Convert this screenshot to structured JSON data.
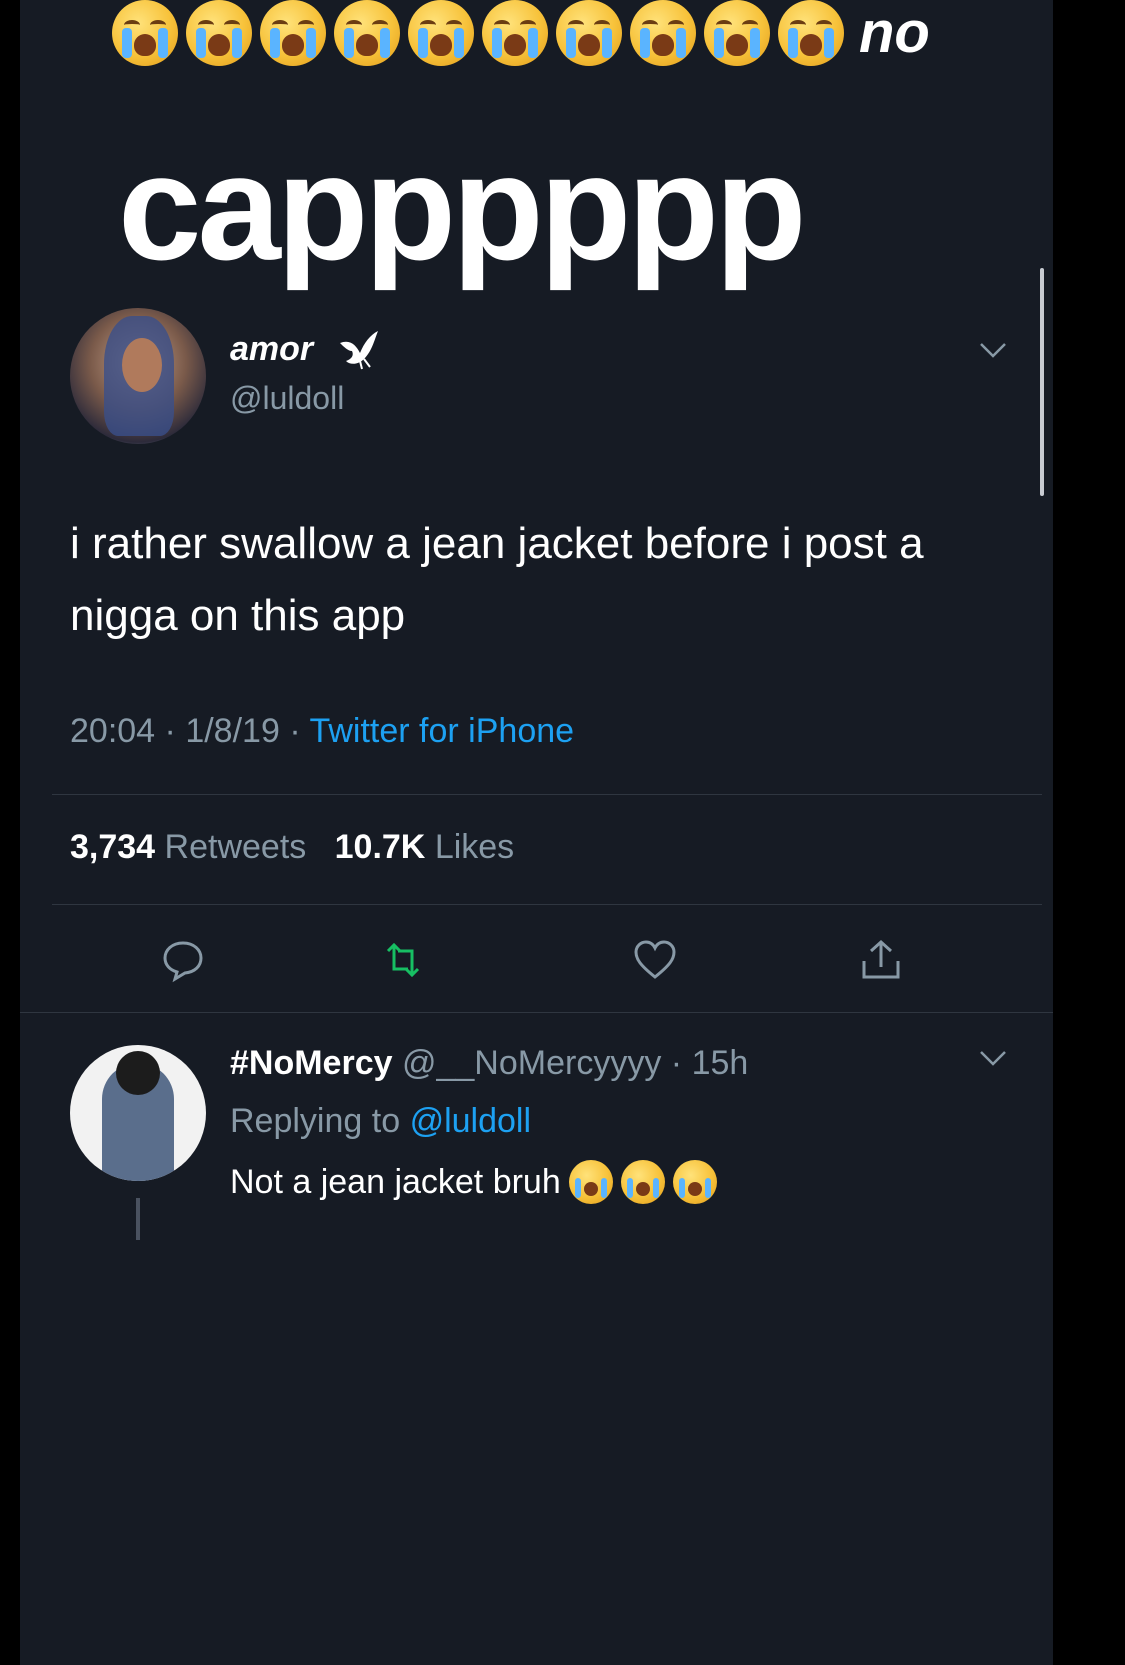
{
  "overlay": {
    "emoji_count": 10,
    "emoji_icon": "loudly-crying-face",
    "small_text": "no",
    "big_text": "capppppp"
  },
  "tweet": {
    "display_name": "amor",
    "name_badge_icon": "dove-icon",
    "handle": "@luldoll",
    "text": "i rather swallow a jean jacket before i post a nigga on this app",
    "time": "20:04",
    "date": "1/8/19",
    "separator": "·",
    "source": "Twitter for iPhone",
    "retweets_count": "3,734",
    "retweets_label": "Retweets",
    "likes_count": "10.7K",
    "likes_label": "Likes",
    "actions": [
      "reply-icon",
      "retweet-icon",
      "like-icon",
      "share-icon"
    ]
  },
  "reply": {
    "display_name": "#NoMercy",
    "handle": "@__NoMercyyyy",
    "age": "15h",
    "replying_prefix": "Replying to",
    "replying_to": "@luldoll",
    "text": "Not a jean jacket bruh",
    "emoji_count": 3
  },
  "colors": {
    "background": "#161b24",
    "text_primary": "#ffffff",
    "text_secondary": "#8899a6",
    "link": "#1da1f2",
    "retweet_green": "#17bf63"
  }
}
